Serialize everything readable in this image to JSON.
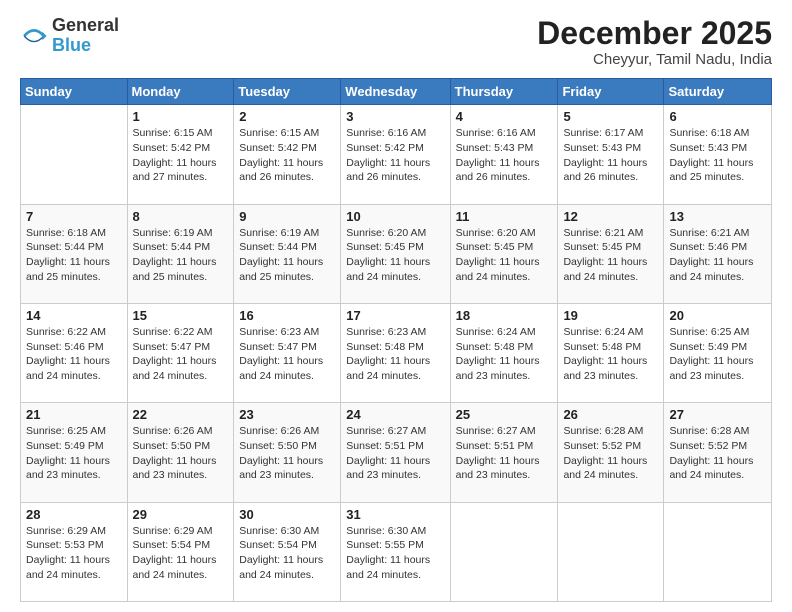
{
  "logo": {
    "line1": "General",
    "line2": "Blue"
  },
  "title": "December 2025",
  "subtitle": "Cheyyur, Tamil Nadu, India",
  "days_of_week": [
    "Sunday",
    "Monday",
    "Tuesday",
    "Wednesday",
    "Thursday",
    "Friday",
    "Saturday"
  ],
  "weeks": [
    [
      {
        "day": "",
        "info": ""
      },
      {
        "day": "1",
        "info": "Sunrise: 6:15 AM\nSunset: 5:42 PM\nDaylight: 11 hours\nand 27 minutes."
      },
      {
        "day": "2",
        "info": "Sunrise: 6:15 AM\nSunset: 5:42 PM\nDaylight: 11 hours\nand 26 minutes."
      },
      {
        "day": "3",
        "info": "Sunrise: 6:16 AM\nSunset: 5:42 PM\nDaylight: 11 hours\nand 26 minutes."
      },
      {
        "day": "4",
        "info": "Sunrise: 6:16 AM\nSunset: 5:43 PM\nDaylight: 11 hours\nand 26 minutes."
      },
      {
        "day": "5",
        "info": "Sunrise: 6:17 AM\nSunset: 5:43 PM\nDaylight: 11 hours\nand 26 minutes."
      },
      {
        "day": "6",
        "info": "Sunrise: 6:18 AM\nSunset: 5:43 PM\nDaylight: 11 hours\nand 25 minutes."
      }
    ],
    [
      {
        "day": "7",
        "info": "Sunrise: 6:18 AM\nSunset: 5:44 PM\nDaylight: 11 hours\nand 25 minutes."
      },
      {
        "day": "8",
        "info": "Sunrise: 6:19 AM\nSunset: 5:44 PM\nDaylight: 11 hours\nand 25 minutes."
      },
      {
        "day": "9",
        "info": "Sunrise: 6:19 AM\nSunset: 5:44 PM\nDaylight: 11 hours\nand 25 minutes."
      },
      {
        "day": "10",
        "info": "Sunrise: 6:20 AM\nSunset: 5:45 PM\nDaylight: 11 hours\nand 24 minutes."
      },
      {
        "day": "11",
        "info": "Sunrise: 6:20 AM\nSunset: 5:45 PM\nDaylight: 11 hours\nand 24 minutes."
      },
      {
        "day": "12",
        "info": "Sunrise: 6:21 AM\nSunset: 5:45 PM\nDaylight: 11 hours\nand 24 minutes."
      },
      {
        "day": "13",
        "info": "Sunrise: 6:21 AM\nSunset: 5:46 PM\nDaylight: 11 hours\nand 24 minutes."
      }
    ],
    [
      {
        "day": "14",
        "info": "Sunrise: 6:22 AM\nSunset: 5:46 PM\nDaylight: 11 hours\nand 24 minutes."
      },
      {
        "day": "15",
        "info": "Sunrise: 6:22 AM\nSunset: 5:47 PM\nDaylight: 11 hours\nand 24 minutes."
      },
      {
        "day": "16",
        "info": "Sunrise: 6:23 AM\nSunset: 5:47 PM\nDaylight: 11 hours\nand 24 minutes."
      },
      {
        "day": "17",
        "info": "Sunrise: 6:23 AM\nSunset: 5:48 PM\nDaylight: 11 hours\nand 24 minutes."
      },
      {
        "day": "18",
        "info": "Sunrise: 6:24 AM\nSunset: 5:48 PM\nDaylight: 11 hours\nand 23 minutes."
      },
      {
        "day": "19",
        "info": "Sunrise: 6:24 AM\nSunset: 5:48 PM\nDaylight: 11 hours\nand 23 minutes."
      },
      {
        "day": "20",
        "info": "Sunrise: 6:25 AM\nSunset: 5:49 PM\nDaylight: 11 hours\nand 23 minutes."
      }
    ],
    [
      {
        "day": "21",
        "info": "Sunrise: 6:25 AM\nSunset: 5:49 PM\nDaylight: 11 hours\nand 23 minutes."
      },
      {
        "day": "22",
        "info": "Sunrise: 6:26 AM\nSunset: 5:50 PM\nDaylight: 11 hours\nand 23 minutes."
      },
      {
        "day": "23",
        "info": "Sunrise: 6:26 AM\nSunset: 5:50 PM\nDaylight: 11 hours\nand 23 minutes."
      },
      {
        "day": "24",
        "info": "Sunrise: 6:27 AM\nSunset: 5:51 PM\nDaylight: 11 hours\nand 23 minutes."
      },
      {
        "day": "25",
        "info": "Sunrise: 6:27 AM\nSunset: 5:51 PM\nDaylight: 11 hours\nand 23 minutes."
      },
      {
        "day": "26",
        "info": "Sunrise: 6:28 AM\nSunset: 5:52 PM\nDaylight: 11 hours\nand 24 minutes."
      },
      {
        "day": "27",
        "info": "Sunrise: 6:28 AM\nSunset: 5:52 PM\nDaylight: 11 hours\nand 24 minutes."
      }
    ],
    [
      {
        "day": "28",
        "info": "Sunrise: 6:29 AM\nSunset: 5:53 PM\nDaylight: 11 hours\nand 24 minutes."
      },
      {
        "day": "29",
        "info": "Sunrise: 6:29 AM\nSunset: 5:54 PM\nDaylight: 11 hours\nand 24 minutes."
      },
      {
        "day": "30",
        "info": "Sunrise: 6:30 AM\nSunset: 5:54 PM\nDaylight: 11 hours\nand 24 minutes."
      },
      {
        "day": "31",
        "info": "Sunrise: 6:30 AM\nSunset: 5:55 PM\nDaylight: 11 hours\nand 24 minutes."
      },
      {
        "day": "",
        "info": ""
      },
      {
        "day": "",
        "info": ""
      },
      {
        "day": "",
        "info": ""
      }
    ]
  ]
}
